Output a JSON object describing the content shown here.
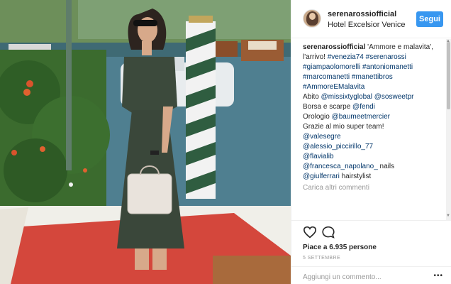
{
  "post": {
    "username": "serenarossiofficial",
    "location": "Hotel Excelsior Venice",
    "follow_label": "Segui",
    "caption": {
      "username": "serenarossiofficial",
      "text_1": " 'Ammore e malavita',",
      "text_2": "l'arrivo! ",
      "tag_venezia": "#venezia74",
      "tag_serena": "#serenarossi",
      "tag_giampaolo": "#giampaolomorelli",
      "tag_antonio": "#antoniomanetti",
      "tag_marco": "#marcomanetti",
      "tag_manetti": "#manettibros",
      "tag_ammore": "#AmmoreEMalavita",
      "abito": "Abito ",
      "mention_missixty": "@missixtyglobal",
      "mention_sosweet": "@sosweetpr",
      "borsa": "Borsa e scarpe ",
      "mention_fendi": "@fendi",
      "orologio": "Orologio ",
      "mention_baume": "@baumeetmercier",
      "grazie": "Grazie al mio super team!",
      "mention_vale": "@valesegre",
      "mention_alessio": "@alessio_piccirillo_77",
      "mention_flavia": "@flavialib",
      "mention_francesca": "@francesca_napolano_",
      "nails": " nails",
      "mention_giulf": "@giulferrari",
      "hairstylist": " hairstylist"
    },
    "load_more": "Carica altri commenti",
    "likes": "Piace a 6.935 persone",
    "date": "5 SETTEMBRE",
    "add_comment_placeholder": "Aggiungi un commento...",
    "more_icon": "ellipsis-icon",
    "accent_color": "#3897f0"
  }
}
